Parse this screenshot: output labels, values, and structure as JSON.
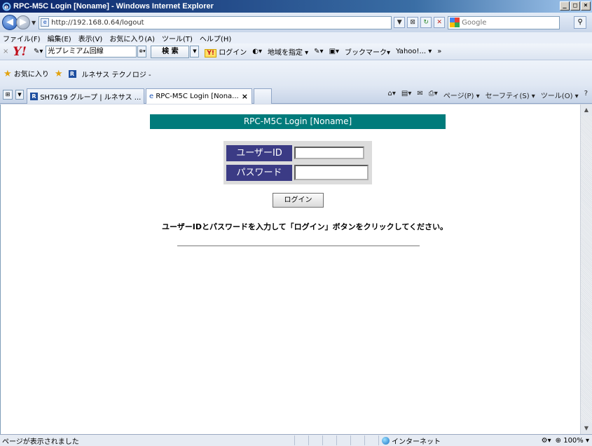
{
  "window": {
    "title": "RPC-M5C Login [Noname] - Windows Internet Explorer",
    "controls": [
      "_",
      "□",
      "×"
    ]
  },
  "address": {
    "url": "http://192.168.0.64/logout",
    "search_placeholder": "Google"
  },
  "menu": [
    "ファイル(F)",
    "編集(E)",
    "表示(V)",
    "お気に入り(A)",
    "ツール(T)",
    "ヘルプ(H)"
  ],
  "yahoo_toolbar": {
    "input_value": "光プレミアム回線",
    "search_label": "検 索",
    "login_badge": "Y!",
    "login_label": "ログイン",
    "region_label": "地域を指定 ▾",
    "bookmark_label": "ブックマーク▾",
    "mail_label": "Yahoo!... ▾",
    "more": "»"
  },
  "favorites": {
    "label": "お気に入り",
    "item": "ルネサス テクノロジ -"
  },
  "tabs": [
    {
      "label": "SH7619 グループ | ルネサス ..."
    },
    {
      "label": "RPC-M5C Login [Nona...",
      "close": "×"
    }
  ],
  "command_bar": {
    "page": "ページ(P) ▾",
    "safety": "セーフティ(S) ▾",
    "tools": "ツール(O) ▾",
    "help": "?"
  },
  "page": {
    "heading": "RPC-M5C Login [Noname]",
    "user_label": "ユーザーID",
    "password_label": "パスワード",
    "login_button": "ログイン",
    "instruction": "ユーザーIDとパスワードを入力して「ログイン」ボタンをクリックしてください。"
  },
  "status": {
    "message": "ページが表示されました",
    "zone": "インターネット",
    "zoom": "100%"
  }
}
